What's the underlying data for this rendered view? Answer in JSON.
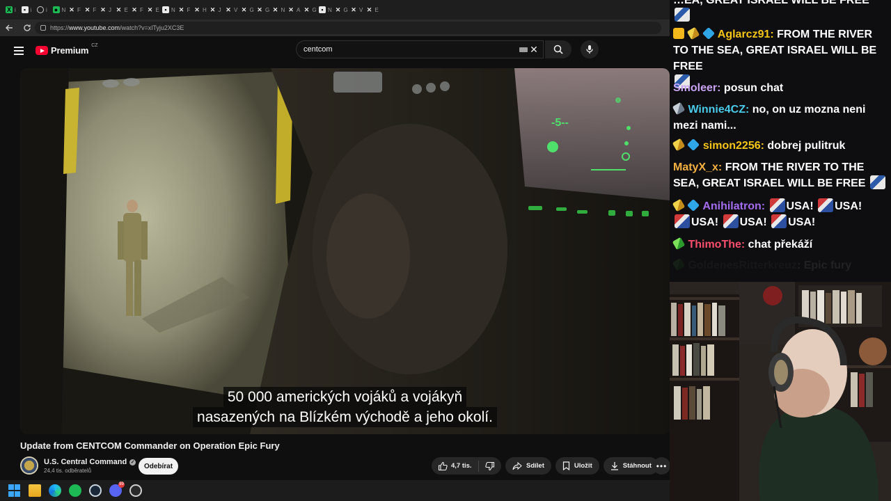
{
  "tabs": {
    "items": [
      {
        "icon": "green-x-icon",
        "letter": "i"
      },
      {
        "icon": "white-square-icon",
        "letter": "i"
      },
      {
        "icon": "globe-icon",
        "letter": "i"
      },
      {
        "icon": "green-square-icon",
        "letter": "N"
      },
      {
        "icon": "x-icon",
        "letter": "F"
      },
      {
        "icon": "x-icon",
        "letter": "F"
      },
      {
        "icon": "x-icon",
        "letter": "J"
      },
      {
        "icon": "x-icon",
        "letter": "E"
      },
      {
        "icon": "x-icon",
        "letter": "F"
      },
      {
        "icon": "x-icon",
        "letter": "E"
      },
      {
        "icon": "white-square-icon",
        "letter": "N"
      },
      {
        "icon": "x-icon",
        "letter": "F"
      },
      {
        "icon": "x-icon",
        "letter": "H"
      },
      {
        "icon": "x-icon",
        "letter": "J"
      },
      {
        "icon": "x-icon",
        "letter": "V"
      },
      {
        "icon": "x-icon",
        "letter": "G"
      },
      {
        "icon": "x-icon",
        "letter": "G"
      },
      {
        "icon": "x-icon",
        "letter": "N"
      },
      {
        "icon": "x-icon",
        "letter": "A"
      },
      {
        "icon": "x-icon",
        "letter": "G"
      },
      {
        "icon": "white-square-icon",
        "letter": "N"
      },
      {
        "icon": "x-icon",
        "letter": "G"
      },
      {
        "icon": "x-icon",
        "letter": "V"
      },
      {
        "icon": "x-icon",
        "letter": "E"
      }
    ]
  },
  "address": {
    "url_prefix": "https://",
    "url_domain": "www.youtube.com",
    "url_path": "/watch?v=xlTyju2XC3E"
  },
  "header": {
    "logo_text": "Premium",
    "country": "CZ",
    "search_value": "centcom"
  },
  "video": {
    "subtitle_line1": "50 000 amerických vojáků a vojákyň",
    "subtitle_line2": "nasazených na Blízkém východě a jeho okolí.",
    "title": "Update from CENTCOM Commander on Operation Epic Fury",
    "channel": "U.S. Central Command",
    "subscribers": "24,4 tis. odběratelů",
    "subscribe_label": "Odebírat",
    "likes": "4,7 tis.",
    "share_label": "Sdílet",
    "save_label": "Uložit",
    "download_label": "Stáhnout"
  },
  "chat": {
    "top_partial": "…EA, GREAT ISRAEL WILL BE FREE",
    "messages": [
      {
        "user": "Aglarcz91",
        "color": "#f5c518",
        "text": "FROM THE RIVER TO THE SEA, GREAT ISRAEL WILL BE FREE"
      },
      {
        "user": "Smoleer",
        "color": "#c9a4f5",
        "text": "posun chat"
      },
      {
        "user": "Winnie4CZ",
        "color": "#4ac9e8",
        "text": "no, on uz mozna neni mezi nami..."
      },
      {
        "user": "simon2256",
        "color": "#f5c518",
        "text": "dobrej pulitruk"
      },
      {
        "user": "MatyX_x",
        "color": "#f5b041",
        "text": "FROM THE RIVER TO THE SEA, GREAT ISRAEL WILL BE FREE"
      },
      {
        "user": "Anihilatron",
        "color": "#a46cf0",
        "text": "USA!"
      },
      {
        "user": "ThimoThe",
        "color": "#ff4d6d",
        "text": "chat překáží"
      },
      {
        "user": "GoldenesRitterkreuz",
        "color": "#777777",
        "text": "Epic fury"
      }
    ]
  },
  "taskbar": {
    "discord_badge": "99"
  }
}
